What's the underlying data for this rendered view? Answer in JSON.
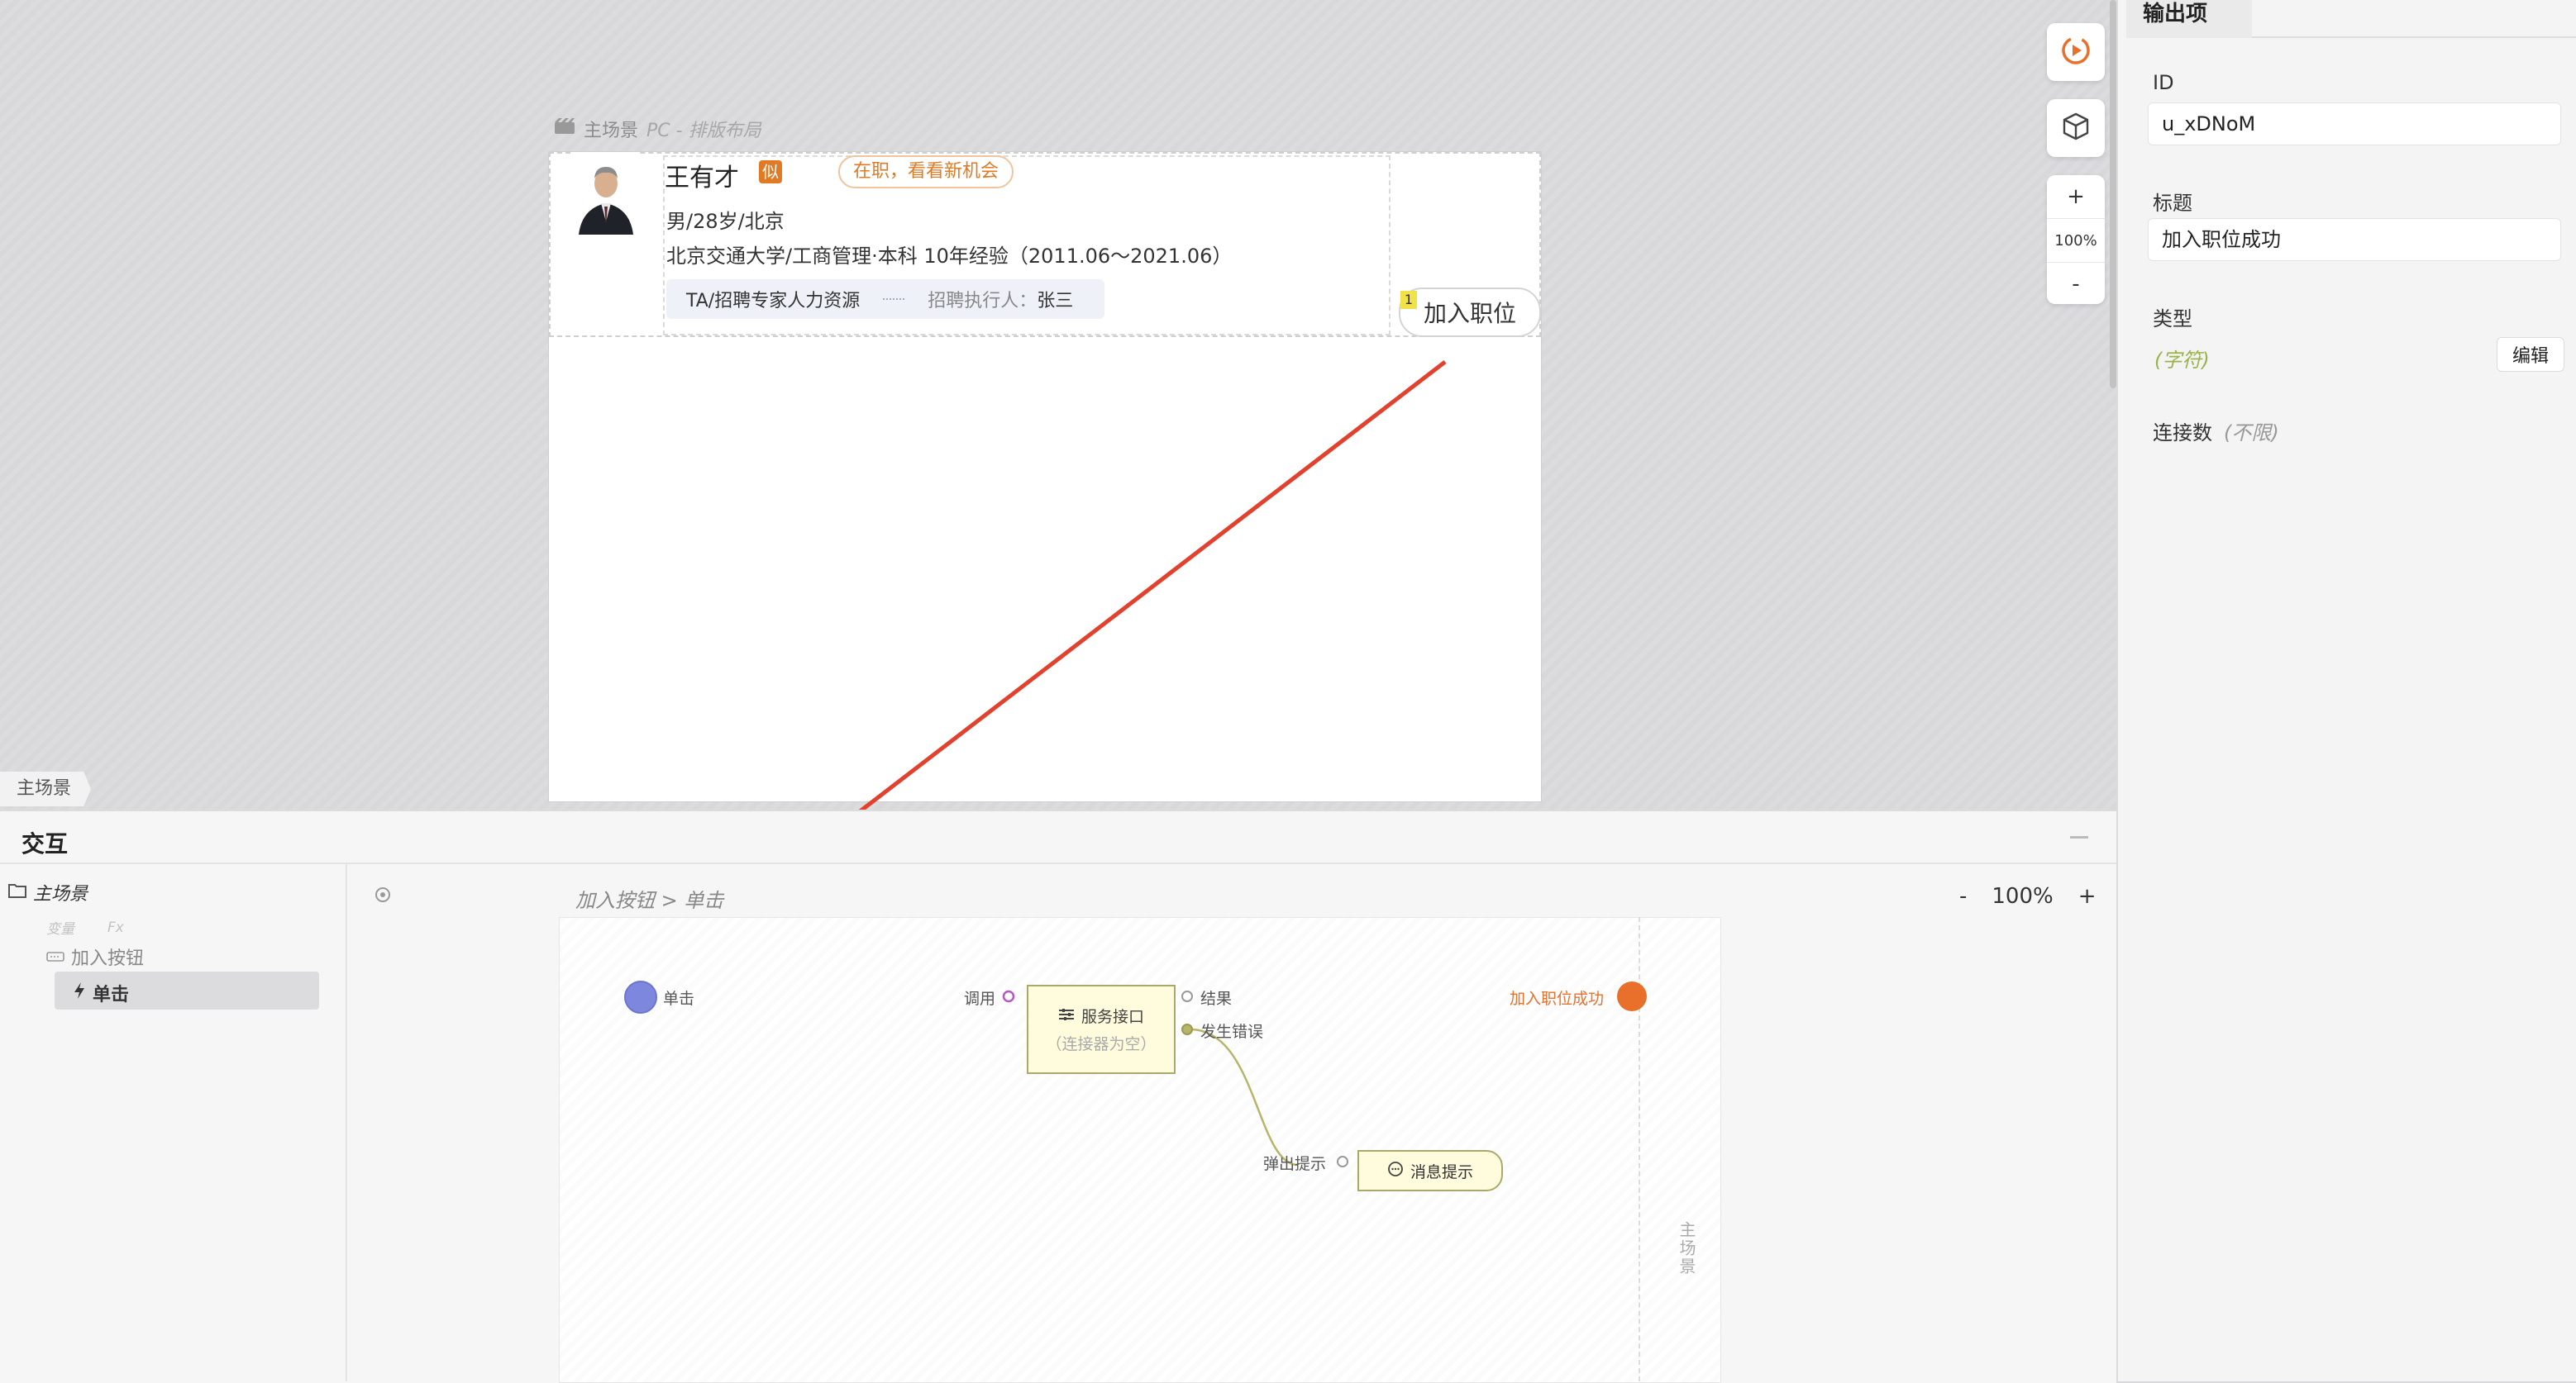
{
  "canvas": {
    "scene_title": "主场景",
    "scene_sub": "PC - 排版布局",
    "card": {
      "name": "王有才",
      "tag": "似",
      "status": "在职，看看新机会",
      "info_line1": "男/28岁/北京",
      "info_line2": "北京交通大学/工商管理·本科  10年经验（2011.06～2021.06）",
      "skill_title": "TA/招聘专家人力资源",
      "recruiter_label": "招聘执行人：",
      "recruiter_name": "张三",
      "join_button": "加入职位",
      "badge": "1"
    },
    "zoom_percent": "100%",
    "zoom_in": "+",
    "zoom_out": "-",
    "scene_tab": "主场景"
  },
  "interaction": {
    "title": "交互",
    "tree": {
      "root": "主场景",
      "vars_label": "变量",
      "fx_label": "Fx",
      "component": "加入按钮",
      "event": "单击"
    },
    "breadcrumb": "加入按钮 > 单击",
    "zoom": {
      "minus": "-",
      "value": "100%",
      "plus": "+"
    },
    "flow": {
      "start_label": "单击",
      "call_label": "调用",
      "service_title": "服务接口",
      "service_sub": "（连接器为空）",
      "result_label": "结果",
      "error_label": "发生错误",
      "output_label": "加入职位成功",
      "popup_label": "弹出提示",
      "msg_node": "消息提示",
      "scene_vertical": "主场景"
    }
  },
  "right_panel": {
    "tab": "输出项",
    "id_label": "ID",
    "id_value": "u_xDNoM",
    "title_label": "标题",
    "title_value": "加入职位成功",
    "type_label": "类型",
    "type_value": "(字符)",
    "edit_button": "编辑",
    "connections_label": "连接数",
    "connections_value": "(不限)"
  },
  "colors": {
    "accent_orange": "#e8702a",
    "start_blue": "#7d87dd",
    "arrow_red": "#e2412d"
  }
}
